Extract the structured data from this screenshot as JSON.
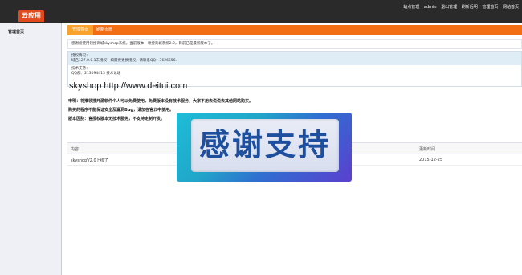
{
  "topbar": {
    "logo": "云应用",
    "links": [
      "站点管理",
      "admin",
      "退出管理",
      "刷新后明",
      "管理首页",
      "网站首页"
    ]
  },
  "sidebar": {
    "title": "管理首页"
  },
  "tabs": [
    {
      "label": "管理首页",
      "active": true
    },
    {
      "label": "刷新页面",
      "active": false
    }
  ],
  "notice": "感谢您使用领搜商城skyshop系统，当前版本：领搜商城系统2.0，目前已是最新版本了。",
  "info": {
    "auth_title": "授权情况：",
    "auth_text": "域名127.0.0.1未授权！如需要更换授权，请联系QQ：3626556.",
    "support_title": "技术支持：",
    "support_text": "QQ群：213094413   技术论坛"
  },
  "headline": "skyshop http://www.deitui.com",
  "statements": [
    "申明：将推领搜开源软件个人可以免费使用，免费版本没有技术服务，大家不用去说说去其他网站购买。",
    "购买的程序不能保证安全及漏洞Bug，请加在官云中使用。",
    "版本区别：官授权版本无技术服务，不支持定制开发。"
  ],
  "table": {
    "headers": [
      "内容",
      "更新时间"
    ],
    "rows": [
      [
        "skyshopV2.0上线了",
        "2015-12-25"
      ]
    ]
  },
  "banner": {
    "text": "感谢支持"
  }
}
